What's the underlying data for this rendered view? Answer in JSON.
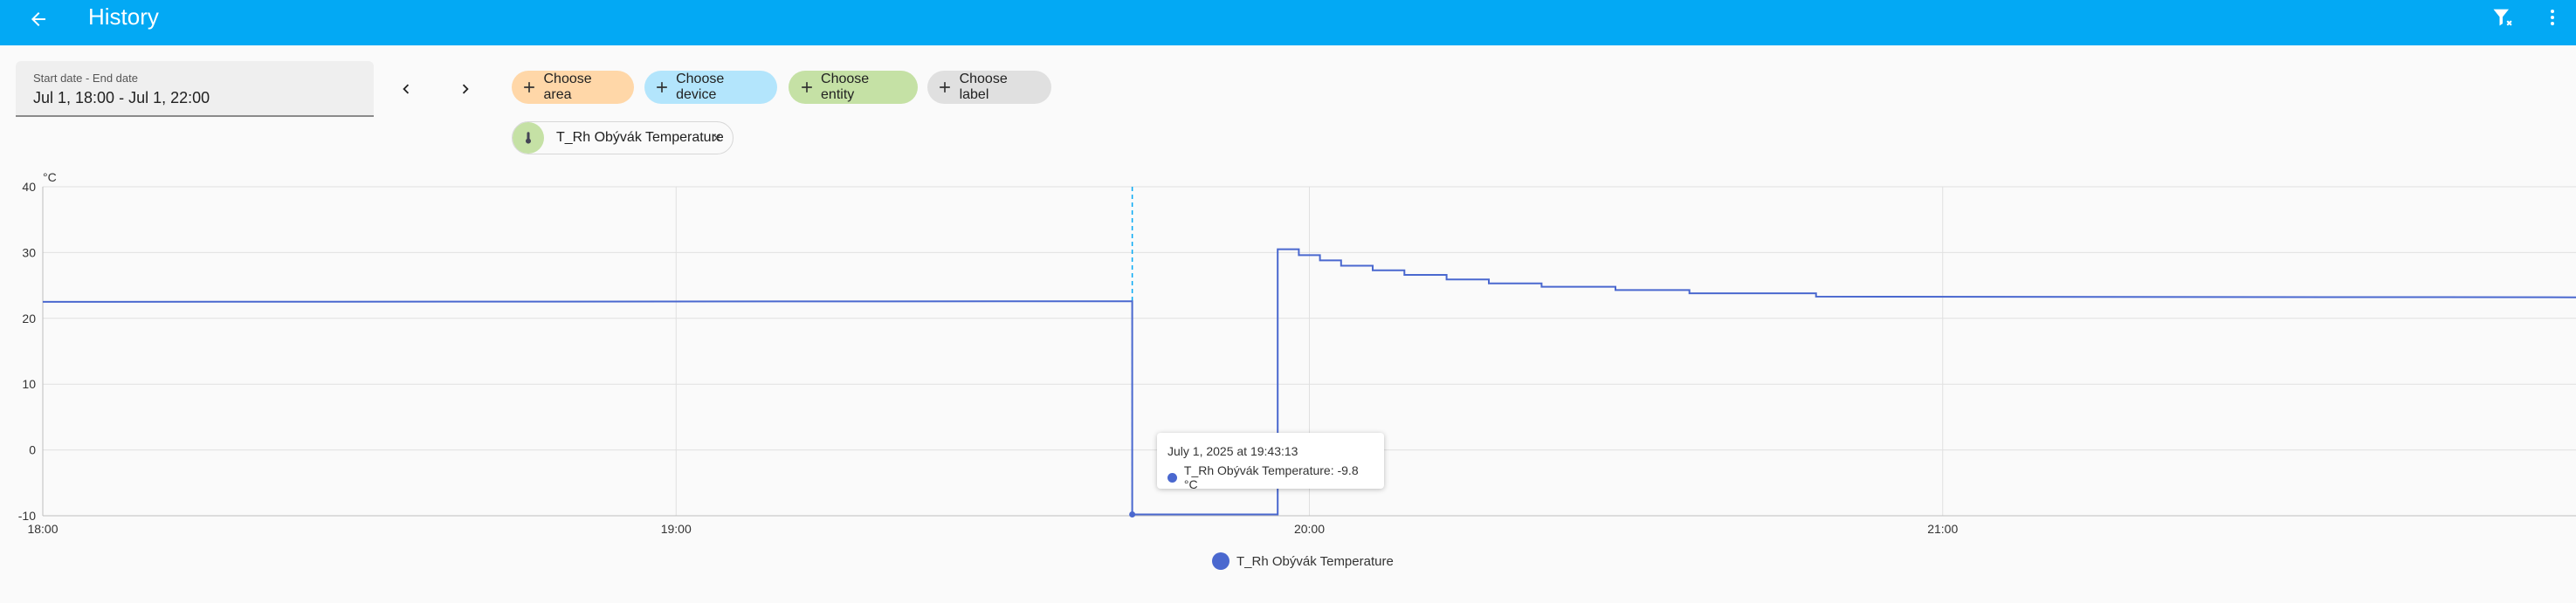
{
  "header": {
    "title": "History"
  },
  "date_range": {
    "label": "Start date - End date",
    "value": "Jul 1, 18:00 - Jul 1, 22:00"
  },
  "targets": [
    {
      "label": "Choose area",
      "color": "#ffd7a8"
    },
    {
      "label": "Choose device",
      "color": "#b3e5fc"
    },
    {
      "label": "Choose entity",
      "color": "#c5e1a5"
    },
    {
      "label": "Choose label",
      "color": "#e0e0e0"
    }
  ],
  "selected_entity": {
    "label": "T_Rh Obývák Temperature"
  },
  "tooltip": {
    "time": "July 1, 2025 at 19:43:13",
    "text": "T_Rh Obývák Temperature: -9.8 °C"
  },
  "chart_data": {
    "type": "line",
    "ylabel": "°C",
    "ylim": [
      -10,
      40
    ],
    "yticks": [
      -10,
      0,
      10,
      20,
      30,
      40
    ],
    "xlim": [
      "18:00",
      "22:00"
    ],
    "xticks": [
      "18:00",
      "19:00",
      "20:00",
      "21:00"
    ],
    "grid": true,
    "legend": "bottom-center",
    "color": "#4a68cf",
    "cursor_time": "19:43:13",
    "series": [
      {
        "name": "T_Rh Obývák Temperature",
        "step": true,
        "points": [
          [
            "18:00",
            22.5
          ],
          [
            "19:43:13",
            22.6
          ],
          [
            "19:43:13",
            -9.8
          ],
          [
            "19:57",
            -9.8
          ],
          [
            "19:57",
            30.5
          ],
          [
            "19:59",
            30.5
          ],
          [
            "19:59",
            29.6
          ],
          [
            "20:01",
            29.6
          ],
          [
            "20:01",
            28.8
          ],
          [
            "20:03",
            28.8
          ],
          [
            "20:03",
            28.0
          ],
          [
            "20:06",
            28.0
          ],
          [
            "20:06",
            27.3
          ],
          [
            "20:09",
            27.3
          ],
          [
            "20:09",
            26.6
          ],
          [
            "20:13",
            26.6
          ],
          [
            "20:13",
            25.9
          ],
          [
            "20:17",
            25.9
          ],
          [
            "20:17",
            25.3
          ],
          [
            "20:22",
            25.3
          ],
          [
            "20:22",
            24.8
          ],
          [
            "20:29",
            24.8
          ],
          [
            "20:29",
            24.3
          ],
          [
            "20:36",
            24.3
          ],
          [
            "20:36",
            23.8
          ],
          [
            "20:48",
            23.8
          ],
          [
            "20:48",
            23.3
          ],
          [
            "22:00",
            23.2
          ]
        ]
      }
    ]
  }
}
